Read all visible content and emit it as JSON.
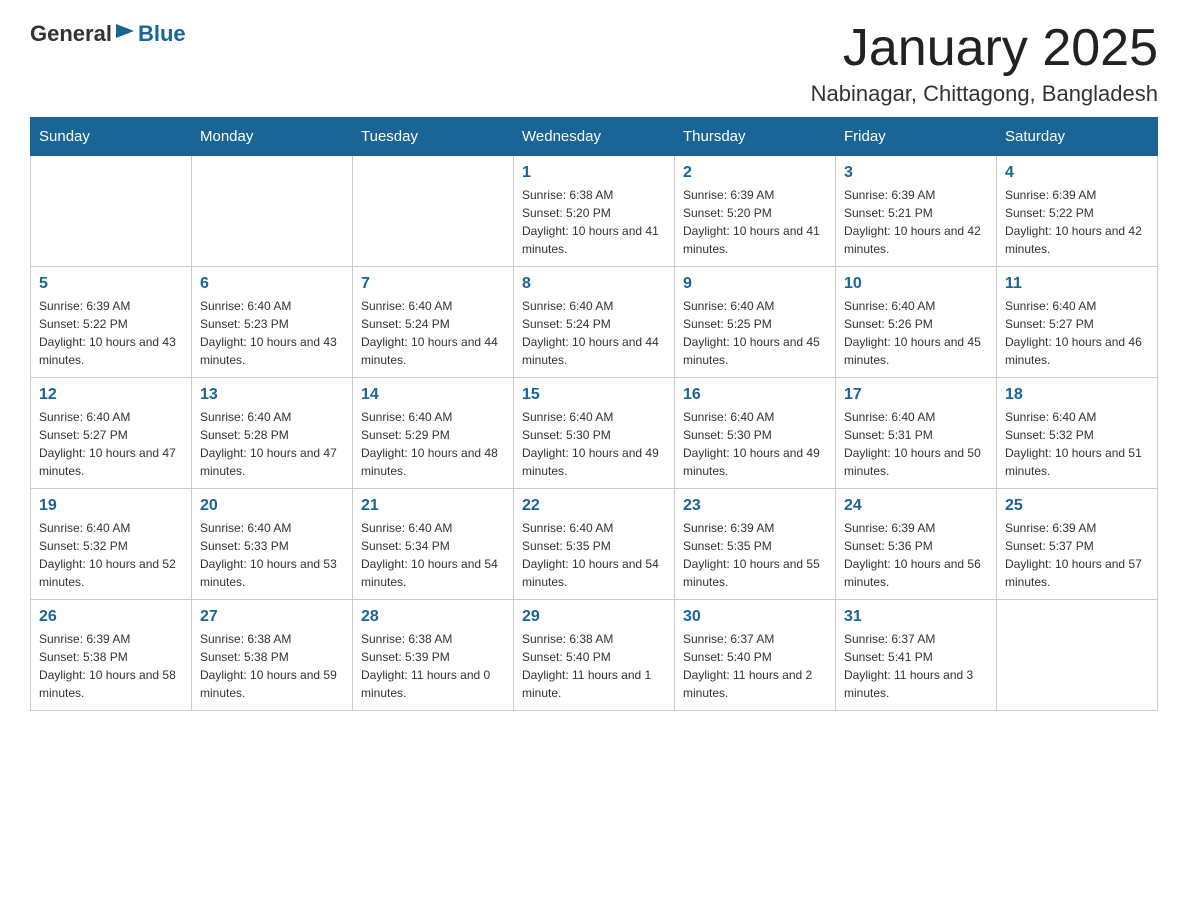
{
  "header": {
    "logo_general": "General",
    "logo_blue": "Blue",
    "month_title": "January 2025",
    "location": "Nabinagar, Chittagong, Bangladesh"
  },
  "weekdays": [
    "Sunday",
    "Monday",
    "Tuesday",
    "Wednesday",
    "Thursday",
    "Friday",
    "Saturday"
  ],
  "weeks": [
    [
      {
        "day": "",
        "sunrise": "",
        "sunset": "",
        "daylight": ""
      },
      {
        "day": "",
        "sunrise": "",
        "sunset": "",
        "daylight": ""
      },
      {
        "day": "",
        "sunrise": "",
        "sunset": "",
        "daylight": ""
      },
      {
        "day": "1",
        "sunrise": "Sunrise: 6:38 AM",
        "sunset": "Sunset: 5:20 PM",
        "daylight": "Daylight: 10 hours and 41 minutes."
      },
      {
        "day": "2",
        "sunrise": "Sunrise: 6:39 AM",
        "sunset": "Sunset: 5:20 PM",
        "daylight": "Daylight: 10 hours and 41 minutes."
      },
      {
        "day": "3",
        "sunrise": "Sunrise: 6:39 AM",
        "sunset": "Sunset: 5:21 PM",
        "daylight": "Daylight: 10 hours and 42 minutes."
      },
      {
        "day": "4",
        "sunrise": "Sunrise: 6:39 AM",
        "sunset": "Sunset: 5:22 PM",
        "daylight": "Daylight: 10 hours and 42 minutes."
      }
    ],
    [
      {
        "day": "5",
        "sunrise": "Sunrise: 6:39 AM",
        "sunset": "Sunset: 5:22 PM",
        "daylight": "Daylight: 10 hours and 43 minutes."
      },
      {
        "day": "6",
        "sunrise": "Sunrise: 6:40 AM",
        "sunset": "Sunset: 5:23 PM",
        "daylight": "Daylight: 10 hours and 43 minutes."
      },
      {
        "day": "7",
        "sunrise": "Sunrise: 6:40 AM",
        "sunset": "Sunset: 5:24 PM",
        "daylight": "Daylight: 10 hours and 44 minutes."
      },
      {
        "day": "8",
        "sunrise": "Sunrise: 6:40 AM",
        "sunset": "Sunset: 5:24 PM",
        "daylight": "Daylight: 10 hours and 44 minutes."
      },
      {
        "day": "9",
        "sunrise": "Sunrise: 6:40 AM",
        "sunset": "Sunset: 5:25 PM",
        "daylight": "Daylight: 10 hours and 45 minutes."
      },
      {
        "day": "10",
        "sunrise": "Sunrise: 6:40 AM",
        "sunset": "Sunset: 5:26 PM",
        "daylight": "Daylight: 10 hours and 45 minutes."
      },
      {
        "day": "11",
        "sunrise": "Sunrise: 6:40 AM",
        "sunset": "Sunset: 5:27 PM",
        "daylight": "Daylight: 10 hours and 46 minutes."
      }
    ],
    [
      {
        "day": "12",
        "sunrise": "Sunrise: 6:40 AM",
        "sunset": "Sunset: 5:27 PM",
        "daylight": "Daylight: 10 hours and 47 minutes."
      },
      {
        "day": "13",
        "sunrise": "Sunrise: 6:40 AM",
        "sunset": "Sunset: 5:28 PM",
        "daylight": "Daylight: 10 hours and 47 minutes."
      },
      {
        "day": "14",
        "sunrise": "Sunrise: 6:40 AM",
        "sunset": "Sunset: 5:29 PM",
        "daylight": "Daylight: 10 hours and 48 minutes."
      },
      {
        "day": "15",
        "sunrise": "Sunrise: 6:40 AM",
        "sunset": "Sunset: 5:30 PM",
        "daylight": "Daylight: 10 hours and 49 minutes."
      },
      {
        "day": "16",
        "sunrise": "Sunrise: 6:40 AM",
        "sunset": "Sunset: 5:30 PM",
        "daylight": "Daylight: 10 hours and 49 minutes."
      },
      {
        "day": "17",
        "sunrise": "Sunrise: 6:40 AM",
        "sunset": "Sunset: 5:31 PM",
        "daylight": "Daylight: 10 hours and 50 minutes."
      },
      {
        "day": "18",
        "sunrise": "Sunrise: 6:40 AM",
        "sunset": "Sunset: 5:32 PM",
        "daylight": "Daylight: 10 hours and 51 minutes."
      }
    ],
    [
      {
        "day": "19",
        "sunrise": "Sunrise: 6:40 AM",
        "sunset": "Sunset: 5:32 PM",
        "daylight": "Daylight: 10 hours and 52 minutes."
      },
      {
        "day": "20",
        "sunrise": "Sunrise: 6:40 AM",
        "sunset": "Sunset: 5:33 PM",
        "daylight": "Daylight: 10 hours and 53 minutes."
      },
      {
        "day": "21",
        "sunrise": "Sunrise: 6:40 AM",
        "sunset": "Sunset: 5:34 PM",
        "daylight": "Daylight: 10 hours and 54 minutes."
      },
      {
        "day": "22",
        "sunrise": "Sunrise: 6:40 AM",
        "sunset": "Sunset: 5:35 PM",
        "daylight": "Daylight: 10 hours and 54 minutes."
      },
      {
        "day": "23",
        "sunrise": "Sunrise: 6:39 AM",
        "sunset": "Sunset: 5:35 PM",
        "daylight": "Daylight: 10 hours and 55 minutes."
      },
      {
        "day": "24",
        "sunrise": "Sunrise: 6:39 AM",
        "sunset": "Sunset: 5:36 PM",
        "daylight": "Daylight: 10 hours and 56 minutes."
      },
      {
        "day": "25",
        "sunrise": "Sunrise: 6:39 AM",
        "sunset": "Sunset: 5:37 PM",
        "daylight": "Daylight: 10 hours and 57 minutes."
      }
    ],
    [
      {
        "day": "26",
        "sunrise": "Sunrise: 6:39 AM",
        "sunset": "Sunset: 5:38 PM",
        "daylight": "Daylight: 10 hours and 58 minutes."
      },
      {
        "day": "27",
        "sunrise": "Sunrise: 6:38 AM",
        "sunset": "Sunset: 5:38 PM",
        "daylight": "Daylight: 10 hours and 59 minutes."
      },
      {
        "day": "28",
        "sunrise": "Sunrise: 6:38 AM",
        "sunset": "Sunset: 5:39 PM",
        "daylight": "Daylight: 11 hours and 0 minutes."
      },
      {
        "day": "29",
        "sunrise": "Sunrise: 6:38 AM",
        "sunset": "Sunset: 5:40 PM",
        "daylight": "Daylight: 11 hours and 1 minute."
      },
      {
        "day": "30",
        "sunrise": "Sunrise: 6:37 AM",
        "sunset": "Sunset: 5:40 PM",
        "daylight": "Daylight: 11 hours and 2 minutes."
      },
      {
        "day": "31",
        "sunrise": "Sunrise: 6:37 AM",
        "sunset": "Sunset: 5:41 PM",
        "daylight": "Daylight: 11 hours and 3 minutes."
      },
      {
        "day": "",
        "sunrise": "",
        "sunset": "",
        "daylight": ""
      }
    ]
  ]
}
